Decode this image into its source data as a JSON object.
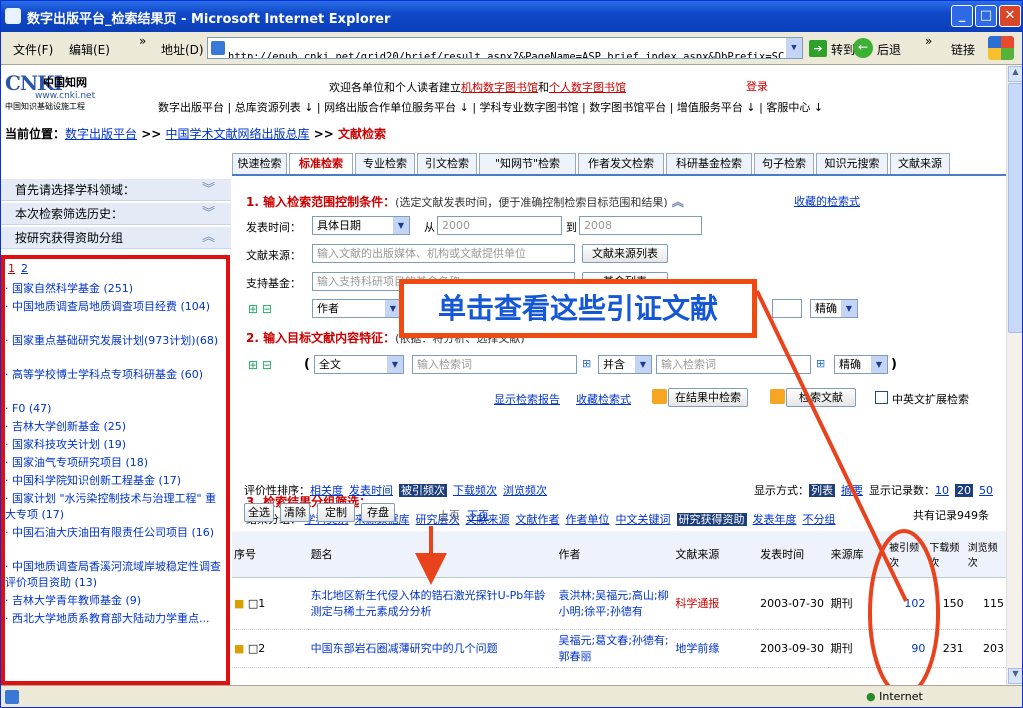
{
  "window": {
    "title": "数字出版平台_检索结果页 - Microsoft Internet Explorer"
  },
  "menu": {
    "file": "文件(F)",
    "edit": "编辑(E)",
    "more": "»",
    "address_label": "地址(D)",
    "address": "http://epub.cnki.net/grid20/brief/result.aspx?&PageName=ASP.brief_index_aspx&DbPrefix=SC",
    "go": "转到",
    "back": "后退",
    "more2": "»",
    "links": "链接"
  },
  "logo": {
    "main": "CNKI",
    "cn": "中国知网",
    "url": "www.cnki.net",
    "sub": "中国知识基础设施工程"
  },
  "header": {
    "welcome_pre": "欢迎各单位和个人读者建立",
    "welcome_link1": "机构数字图书馆",
    "welcome_mid": "和",
    "welcome_link2": "个人数字图书馆",
    "login": "登录",
    "nav": "数字出版平台 | 总库资源列表 ↓ | 网络出版合作单位服务平台 ↓ | 学科专业数字图书馆 | 数字图书馆平台 | 增值服务平台 ↓ | 客服中心 ↓"
  },
  "breadcrumb": {
    "label": "当前位置：",
    "item1": "数字出版平台",
    "sep": ">>",
    "item2": "中国学术文献网络出版总库",
    "item3": "文献检索"
  },
  "tabs": [
    "快速检索",
    "标准检索",
    "专业检索",
    "引文检索",
    "\"知网节\"检索",
    "作者发文检索",
    "科研基金检索",
    "句子检索",
    "知识元搜索",
    "文献来源"
  ],
  "sidebar": {
    "h1": "首先请选择学科领域：",
    "h2": "本次检索筛选历史：",
    "h3": "按研究获得资助分组",
    "page1": "1",
    "page2": "2",
    "items": [
      "· 国家自然科学基金 (251)",
      "· 中国地质调查局地质调查项目经费 (104)",
      "· 国家重点基础研究发展计划(973计划)(68)",
      "· 高等学校博士学科点专项科研基金 (60)",
      "· F0 (47)",
      "· 吉林大学创新基金 (25)",
      "· 国家科技攻关计划 (19)",
      "· 国家油气专项研究项目 (18)",
      "· 中国科学院知识创新工程基金 (17)",
      "· 国家计划 \"水污染控制技术与治理工程\" 重大专项 (17)",
      "· 中国石油大庆油田有限责任公司项目 (16)",
      "· 中国地质调查局香溪河流域岸坡稳定性调查评价项目资助 (13)",
      "· 吉林大学青年教师基金 (9)",
      "· 西北大学地质系教育部大陆动力学重点..."
    ]
  },
  "sec1": {
    "title": "1. 输入检索范围控制条件：",
    "hint": "(选定文献发表时间，便于准确控制检索目标范围和结果)",
    "fav": "收藏的检索式",
    "date_label": "发表时间：",
    "date_mode": "具体日期",
    "from_label": "从",
    "from": "2000",
    "to_label": "到",
    "to": "2008",
    "source_label": "文献来源：",
    "source_ph": "输入文献的出版媒体、机构或文献提供单位",
    "source_btn": "文献来源列表",
    "fund_label": "支持基金：",
    "fund_ph": "输入支持科研项目的基金名称",
    "fund_btn": "基金列表",
    "author_field": "作者",
    "exact": "精确"
  },
  "sec2": {
    "title": "2. 输入目标文献内容特征：",
    "hint": "(依据：将分析、选择文献)",
    "field": "全文",
    "ph1": "输入检索词",
    "op": "并含",
    "ph2": "输入检索词",
    "exact": "精确"
  },
  "actions": {
    "report": "显示检索报告",
    "savequery": "收藏检索式",
    "inresult": "在结果中检索",
    "search": "检索文献",
    "expand": "中英文扩展检索"
  },
  "sec3": {
    "title": "3. 检索结果分组筛选：",
    "group_label": "结果分组：",
    "groups": [
      "学科类别",
      "来源数据库",
      "研究层次",
      "文献来源",
      "文献作者",
      "作者单位",
      "中文关键词",
      "研究获得资助",
      "发表年度",
      "不分组"
    ]
  },
  "sort": {
    "label": "评价性排序：",
    "opts": [
      "相关度",
      "发表时间",
      "被引频次",
      "下载频次",
      "浏览频次"
    ],
    "display_label": "显示方式：",
    "list": "列表",
    "abstract": "摘要",
    "count_label": "显示记录数：",
    "c10": "10",
    "c20": "20",
    "c50": "50",
    "all": "全选",
    "clear": "清除",
    "custom": "定制",
    "save": "存盘",
    "prev": "上页",
    "next": "下页",
    "total": "共有记录949条"
  },
  "table": {
    "headers": [
      "序号",
      "题名",
      "作者",
      "文献来源",
      "发表时间",
      "来源库",
      "被引频次",
      "下载频次",
      "浏览频次"
    ],
    "rows": [
      {
        "no": "1",
        "title": "东北地区新生代侵入体的锆石激光探针U-Pb年龄测定与稀土元素成分分析",
        "author": "袁洪林;吴福元;高山;柳小明;徐平;孙德有",
        "source": "科学通报",
        "date": "2003-07-30",
        "db": "期刊",
        "cited": "102",
        "dl": "150",
        "view": "115"
      },
      {
        "no": "2",
        "title": "中国东部岩石圈减薄研究中的几个问题",
        "author": "吴福元;葛文春;孙德有;郭春丽",
        "source": "地学前缘",
        "date": "2003-09-30",
        "db": "期刊",
        "cited": "90",
        "dl": "231",
        "view": "203"
      }
    ]
  },
  "callout": "单击查看这些引证文献",
  "status": {
    "zone": "Internet"
  },
  "colors": {
    "highlight_red": "#e01010",
    "callout_orange": "#f04a10",
    "link_blue": "#0033cc"
  }
}
